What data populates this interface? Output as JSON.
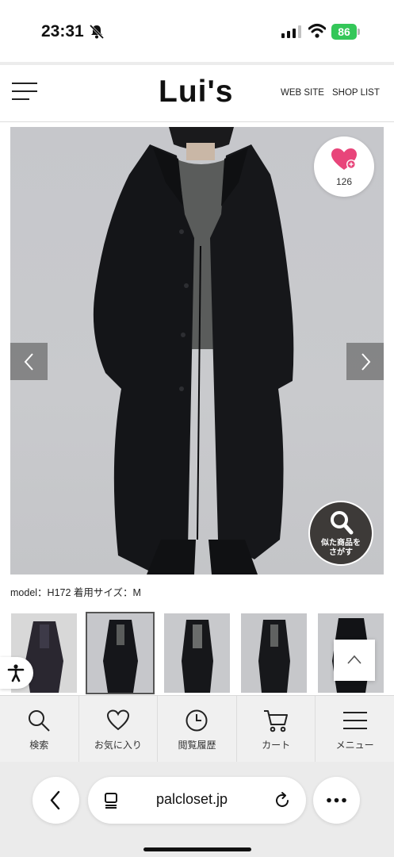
{
  "status_bar": {
    "time": "23:31",
    "battery": "86"
  },
  "header": {
    "logo": "Lui's",
    "links": [
      "WEB SITE",
      "SHOP LIST"
    ]
  },
  "product": {
    "favorite_count": "126",
    "similar_button": {
      "line1": "似た商品を",
      "line2": "さがす"
    },
    "model_info": "model：H172 着用サイズ：M",
    "thumbnail_count": 5,
    "selected_thumbnail": 2
  },
  "bottom_nav": {
    "items": [
      {
        "label": "検索",
        "icon": "search-icon"
      },
      {
        "label": "お気に入り",
        "icon": "heart-icon"
      },
      {
        "label": "閲覧履歴",
        "icon": "clock-icon"
      },
      {
        "label": "カート",
        "icon": "cart-icon"
      },
      {
        "label": "メニュー",
        "icon": "menu-icon"
      }
    ]
  },
  "browser": {
    "url": "palcloset.jp"
  },
  "colors": {
    "accent_pink": "#e8457a",
    "battery_green": "#34c759",
    "button_dark": "#3d3a38"
  }
}
